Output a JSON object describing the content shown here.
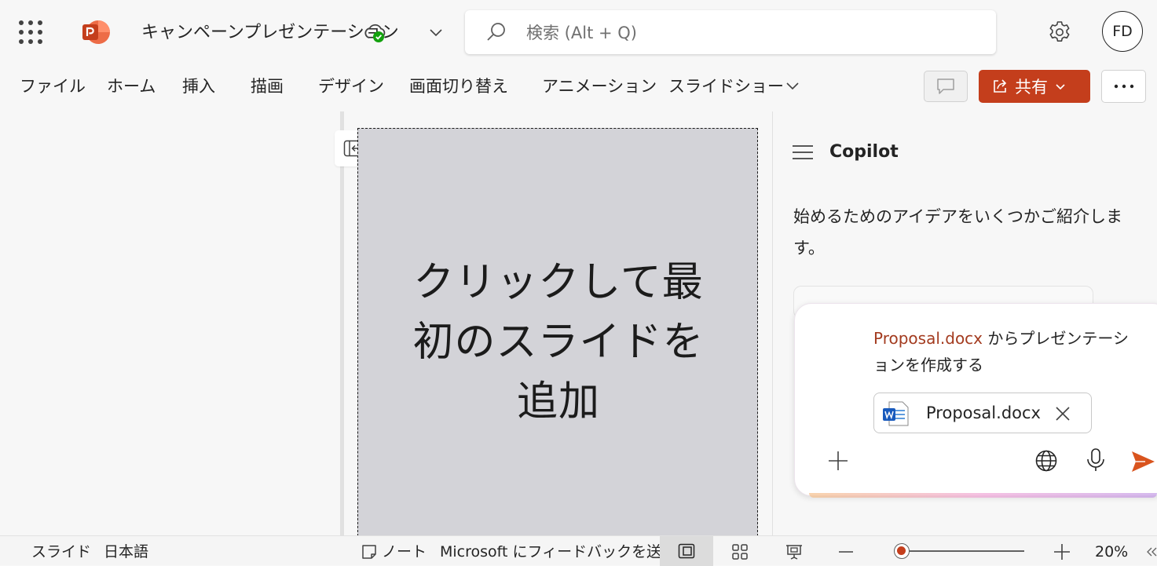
{
  "app": {
    "document_title": "キャンペーンプレゼンテーション",
    "search_placeholder": "検索 (Alt + Q)",
    "avatar_initials": "FD",
    "brand_color": "#c43e1c"
  },
  "ribbon": {
    "tabs": [
      "ファイル",
      "ホーム",
      "挿入",
      "描画",
      "デザイン",
      "画面切り替え",
      "アニメーション",
      "スライドショー"
    ],
    "share_label": "共有"
  },
  "slide": {
    "placeholder_text": "クリックして最初のスライドを追加"
  },
  "copilot": {
    "title": "Copilot",
    "message": "始めるためのアイデアをいくつかご紹介します。",
    "prompt_file": "Proposal.docx",
    "prompt_text": " からプレゼンテーションを作成する",
    "attached_file": "Proposal.docx"
  },
  "statusbar": {
    "slide_label": "スライド",
    "language": "日本語",
    "notes_label": "ノート",
    "feedback_label": "Microsoft にフィードバックを送信",
    "zoom_level": "20%",
    "zoom_fraction": 0.05
  }
}
